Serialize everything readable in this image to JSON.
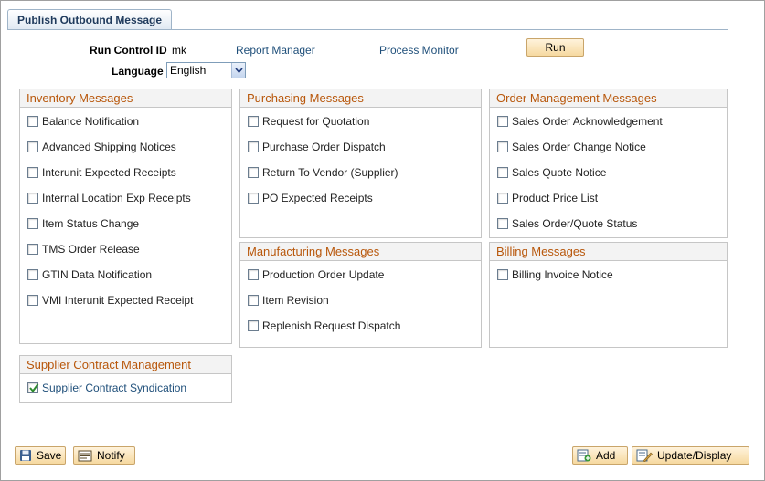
{
  "tab": {
    "title": "Publish Outbound Message"
  },
  "header": {
    "run_control_label": "Run Control ID",
    "run_control_value": "mk",
    "report_manager": "Report Manager",
    "process_monitor": "Process Monitor",
    "run_label": "Run",
    "language_label": "Language",
    "language_value": "English"
  },
  "groups": {
    "inventory": {
      "title": "Inventory Messages",
      "items": [
        {
          "label": "Balance Notification",
          "checked": false
        },
        {
          "label": "Advanced Shipping Notices",
          "checked": false
        },
        {
          "label": "Interunit Expected Receipts",
          "checked": false
        },
        {
          "label": "Internal Location Exp Receipts",
          "checked": false
        },
        {
          "label": "Item Status Change",
          "checked": false
        },
        {
          "label": "TMS Order Release",
          "checked": false
        },
        {
          "label": "GTIN Data Notification",
          "checked": false
        },
        {
          "label": "VMI Interunit Expected Receipt",
          "checked": false
        }
      ]
    },
    "purchasing": {
      "title": "Purchasing Messages",
      "items": [
        {
          "label": "Request for Quotation",
          "checked": false
        },
        {
          "label": "Purchase Order Dispatch",
          "checked": false
        },
        {
          "label": "Return To Vendor (Supplier)",
          "checked": false
        },
        {
          "label": "PO Expected Receipts",
          "checked": false
        }
      ]
    },
    "order_management": {
      "title": "Order Management Messages",
      "items": [
        {
          "label": "Sales Order Acknowledgement",
          "checked": false
        },
        {
          "label": "Sales Order Change Notice",
          "checked": false
        },
        {
          "label": "Sales Quote Notice",
          "checked": false
        },
        {
          "label": "Product Price List",
          "checked": false
        },
        {
          "label": "Sales Order/Quote Status",
          "checked": false
        }
      ]
    },
    "manufacturing": {
      "title": "Manufacturing Messages",
      "items": [
        {
          "label": "Production Order Update",
          "checked": false
        },
        {
          "label": "Item Revision",
          "checked": false
        },
        {
          "label": "Replenish Request Dispatch",
          "checked": false
        }
      ]
    },
    "billing": {
      "title": "Billing Messages",
      "items": [
        {
          "label": "Billing Invoice Notice",
          "checked": false
        }
      ]
    },
    "supplier_contract": {
      "title": "Supplier Contract Management",
      "items": [
        {
          "label": "Supplier Contract Syndication",
          "checked": true
        }
      ]
    }
  },
  "footer": {
    "save": "Save",
    "notify": "Notify",
    "add": "Add",
    "update_display": "Update/Display"
  },
  "icons": {
    "save": "floppy-disk-icon",
    "notify": "notify-icon",
    "add": "add-icon",
    "update_display": "update-display-icon"
  },
  "colors": {
    "group_title": "#b8570b",
    "link": "#1f4f7a",
    "button_bg": "#f6d9a0"
  }
}
